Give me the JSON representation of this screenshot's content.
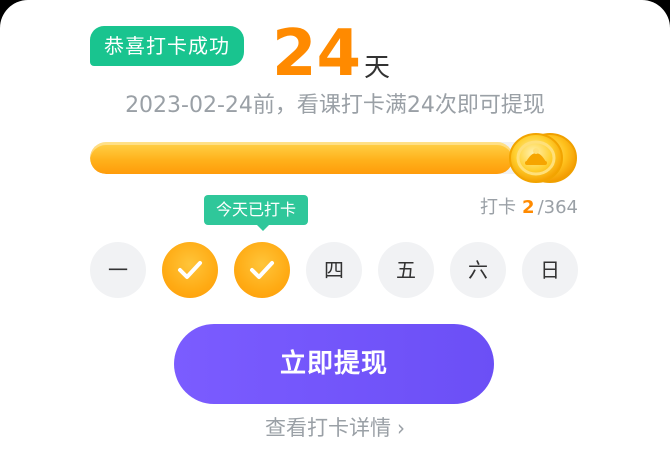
{
  "badge": {
    "label": "恭喜打卡成功"
  },
  "streak": {
    "days": "24",
    "unit": "天"
  },
  "subtitle": "2023-02-24前，看课打卡满24次即可提现",
  "progress": {
    "fraction": 0.9
  },
  "count": {
    "prefix": "打卡",
    "current": "2",
    "separator": "/",
    "total": "364"
  },
  "tooltip": "今天已打卡",
  "week": {
    "days": [
      {
        "label": "一",
        "checked": false
      },
      {
        "label": "",
        "checked": true
      },
      {
        "label": "",
        "checked": true
      },
      {
        "label": "四",
        "checked": false
      },
      {
        "label": "五",
        "checked": false
      },
      {
        "label": "六",
        "checked": false
      },
      {
        "label": "日",
        "checked": false
      }
    ]
  },
  "cta": {
    "label": "立即提现"
  },
  "details": {
    "label": "查看打卡详情",
    "chevron": "›"
  },
  "colors": {
    "accent_orange": "#ff8a00",
    "badge_green": "#19c48f",
    "tooltip_green": "#2fc79a",
    "cta_purple": "#6b4ff6",
    "muted_text": "#9aa0a6"
  },
  "icons": {
    "check": "check-icon",
    "coin": "coin-icon",
    "chevron": "chevron-right-icon"
  }
}
